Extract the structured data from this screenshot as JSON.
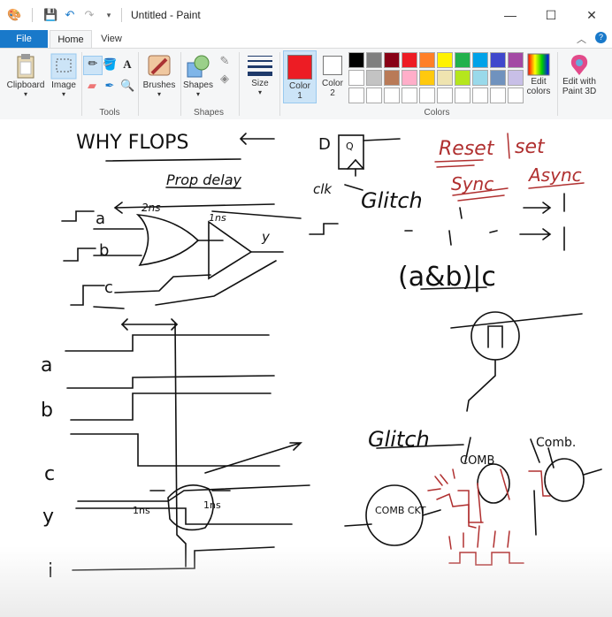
{
  "window": {
    "title": "Untitled - Paint"
  },
  "tabs": {
    "file": "File",
    "home": "Home",
    "view": "View"
  },
  "ribbon": {
    "clipboard": "Clipboard",
    "image": "Image",
    "tools": "Tools",
    "brushes": "Brushes",
    "shapes_btn": "Shapes",
    "shapes_group": "Shapes",
    "size": "Size",
    "color1": "Color\n1",
    "color2": "Color\n2",
    "edit_colors": "Edit\ncolors",
    "edit_paint3d": "Edit with\nPaint 3D",
    "colors_group": "Colors"
  },
  "palette": [
    "#000000",
    "#7f7f7f",
    "#880015",
    "#ed1c24",
    "#ff7f27",
    "#fff200",
    "#22b14c",
    "#00a2e8",
    "#3f48cc",
    "#a349a4",
    "#ffffff",
    "#c3c3c3",
    "#b97a57",
    "#ffaec9",
    "#ffc90e",
    "#efe4b0",
    "#b5e61d",
    "#99d9ea",
    "#7092be",
    "#c8bfe7",
    "#ffffff",
    "#ffffff",
    "#ffffff",
    "#ffffff",
    "#ffffff",
    "#ffffff",
    "#ffffff",
    "#ffffff",
    "#ffffff",
    "#ffffff"
  ],
  "current_colors": {
    "color1": "#ed1c24",
    "color2": "#ffffff"
  },
  "drawing": {
    "heading": "WHY FLOPS",
    "prop_delay": "Prop delay",
    "two_ns": "2ns",
    "one_ns": "1ns",
    "in_a": "a",
    "in_b": "b",
    "in_c": "c",
    "out_y": "y",
    "clk": "clk",
    "ff_d": "D",
    "ff_q": "Q",
    "glitch": "Glitch",
    "abc": "(a&b)|c",
    "reset": "Reset",
    "set": "set",
    "sync": "Sync",
    "async": "Async",
    "glitch2": "Glitch",
    "comb1": "COMB",
    "comb2": "Comb.",
    "ckt": "COMB CKT",
    "wave_a": "a",
    "wave_b": "b",
    "wave_c": "c",
    "wave_y": "y",
    "wave_i": "i",
    "wave_1ns_l": "1ns",
    "wave_1ns_r": "1ns"
  }
}
